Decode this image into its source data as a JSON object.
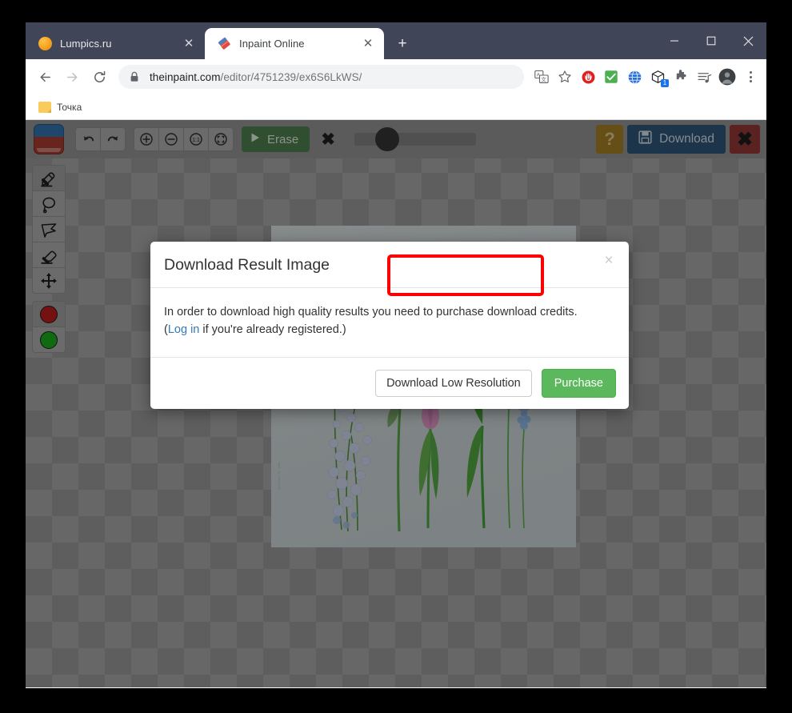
{
  "browser": {
    "tabs": [
      {
        "title": "Lumpics.ru",
        "favicon": "orange-circle-icon",
        "active": false
      },
      {
        "title": "Inpaint Online",
        "favicon": "inpaint-eraser-icon",
        "active": true
      }
    ],
    "new_tab_label": "+",
    "window_controls": {
      "minimize": "minimize-icon",
      "maximize": "maximize-icon",
      "close": "close-icon"
    },
    "nav": {
      "back": "back-arrow-icon",
      "forward": "forward-arrow-icon",
      "reload": "reload-icon"
    },
    "omnibox": {
      "lock": "lock-icon",
      "url_domain": "theinpaint.com",
      "url_path": "/editor/4751239/ex6S6LkWS/"
    },
    "toolbar_icons": [
      "translate-icon",
      "bookmark-star-icon",
      "adblock-icon",
      "checkmark-extension-icon",
      "globe-extension-icon",
      "package-extension-icon",
      "puzzle-extensions-icon",
      "reading-list-icon",
      "profile-avatar-icon",
      "chrome-menu-icon"
    ],
    "package_badge": "1",
    "bookmarks": [
      {
        "label": "Точка",
        "icon": "folder-icon"
      }
    ]
  },
  "app": {
    "logo": "inpaint-logo-icon",
    "toolbar": {
      "undo": "undo-icon",
      "redo": "redo-icon",
      "zoom_in": "zoom-in-icon",
      "zoom_out": "zoom-out-icon",
      "zoom_actual": "1:1",
      "zoom_fit": "fit-screen-icon",
      "erase_label": "Erase",
      "erase_play_icon": "play-icon",
      "cancel_icon": "cancel-x-icon",
      "brush_slider": "brush-size-slider",
      "help_label": "?",
      "download_label": "Download",
      "download_icon": "save-floppy-icon",
      "close_label": "close-x-icon"
    },
    "tools": [
      {
        "name": "marker-tool",
        "icon": "marker-icon",
        "selected": true
      },
      {
        "name": "lasso-tool",
        "icon": "lasso-icon",
        "selected": false
      },
      {
        "name": "polygon-lasso-tool",
        "icon": "polygon-lasso-icon",
        "selected": false
      },
      {
        "name": "eraser-tool",
        "icon": "eraser-icon",
        "selected": false
      },
      {
        "name": "move-tool",
        "icon": "move-arrows-icon",
        "selected": false
      }
    ],
    "swatches": [
      {
        "name": "red-swatch",
        "color": "#b71c1c",
        "selected": true
      },
      {
        "name": "green-swatch",
        "color": "#1aa81a",
        "selected": false
      }
    ],
    "canvas_watermark": "Stock Photo - ID:  ·  photo"
  },
  "modal": {
    "title": "Download Result Image",
    "close_icon": "×",
    "body_line1": "In order to download high quality results you need to purchase download credits.",
    "body_paren_open": "(",
    "body_link": "Log in",
    "body_line2_rest": " if you're already registered.)",
    "buttons": {
      "low_res": "Download Low Resolution",
      "purchase": "Purchase"
    }
  },
  "annotation": {
    "highlight_color": "#ff0000",
    "target": "Download Low Resolution"
  }
}
